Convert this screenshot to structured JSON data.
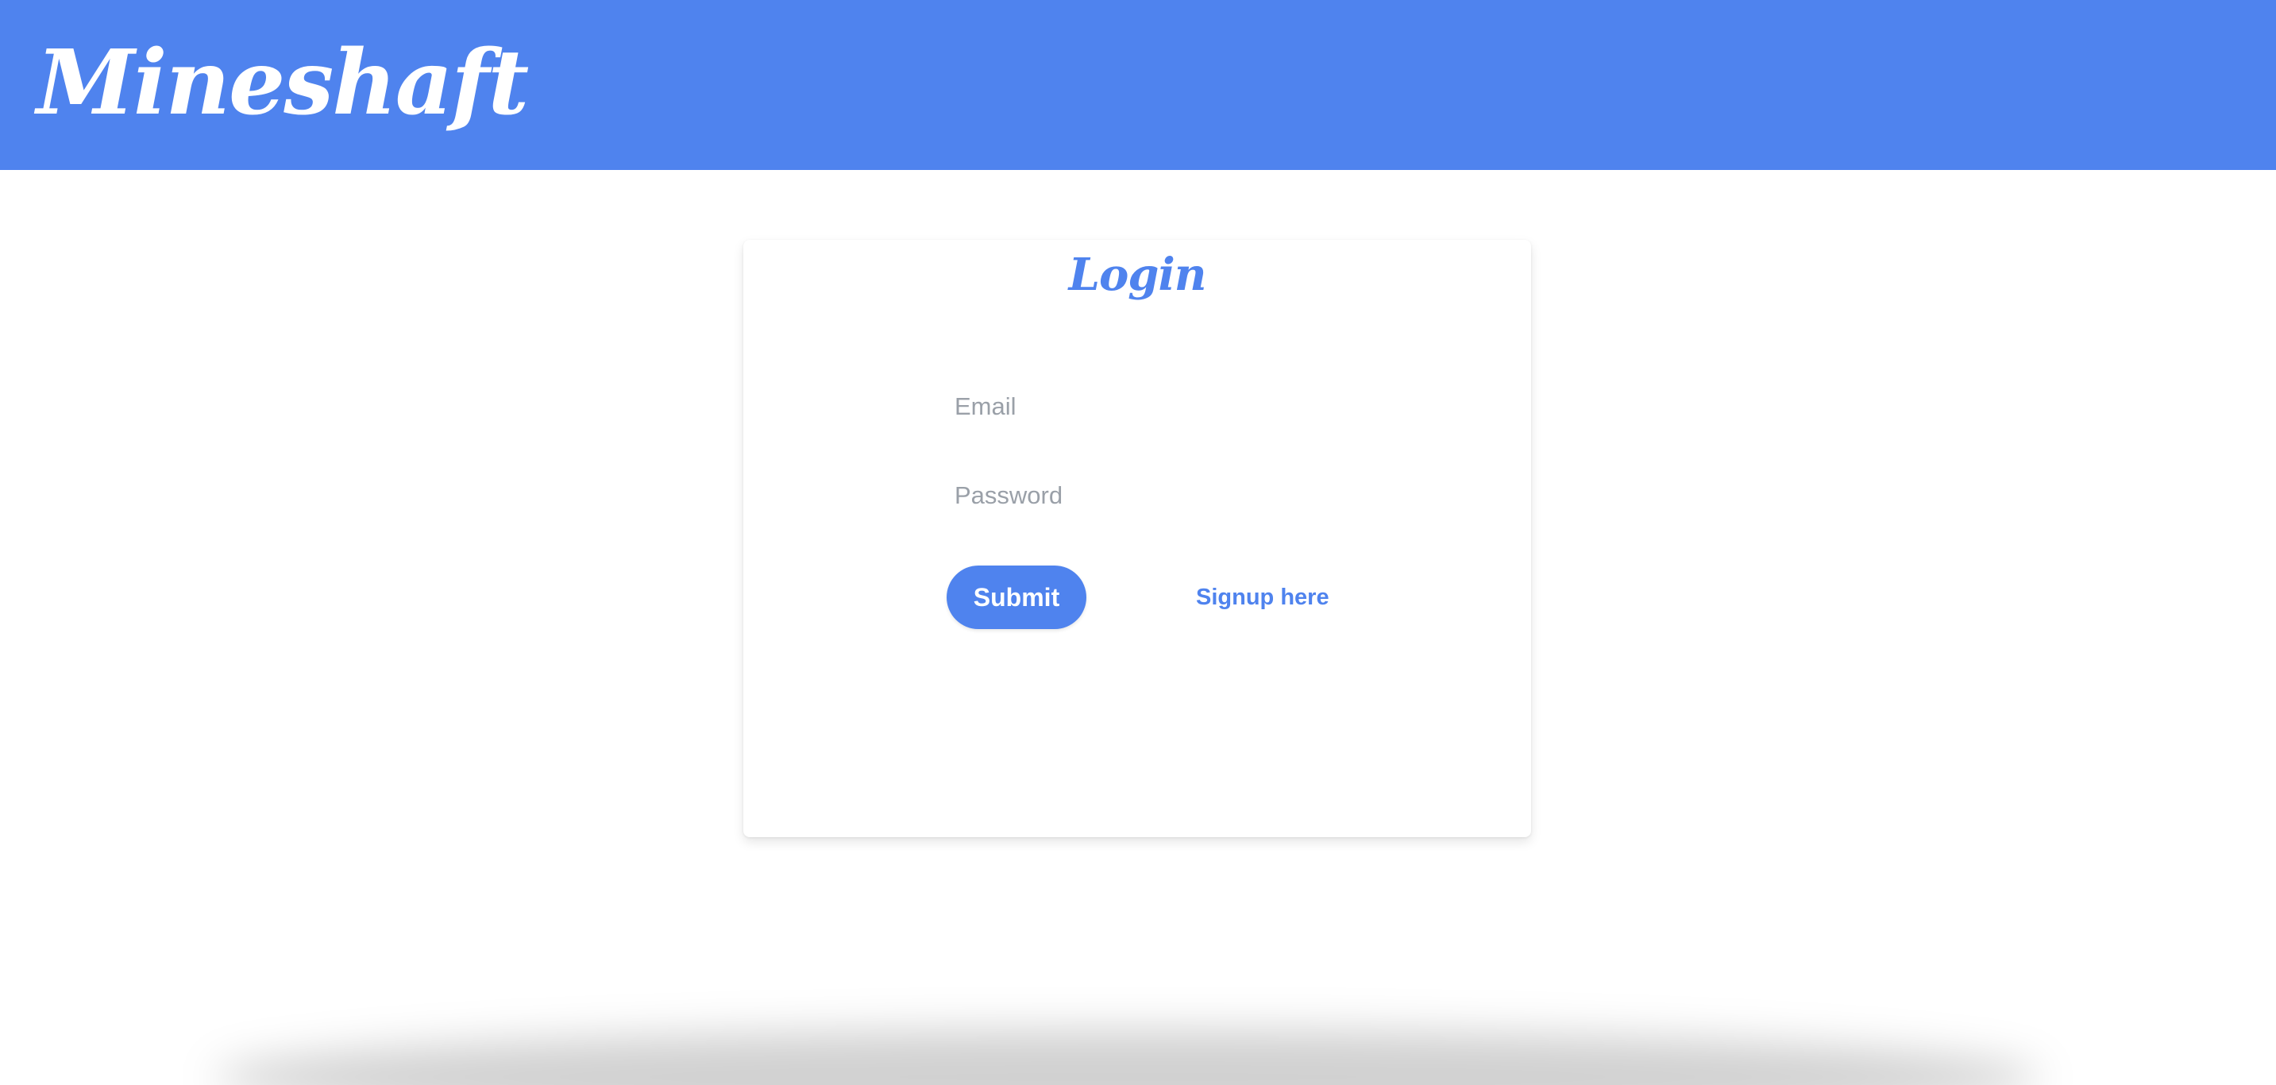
{
  "header": {
    "brand": "Mineshaft",
    "accent_color": "#4f83ee"
  },
  "login": {
    "title": "Login",
    "email_placeholder": "Email",
    "email_value": "",
    "password_placeholder": "Password",
    "password_value": "",
    "submit_label": "Submit",
    "signup_label": "Signup here"
  }
}
